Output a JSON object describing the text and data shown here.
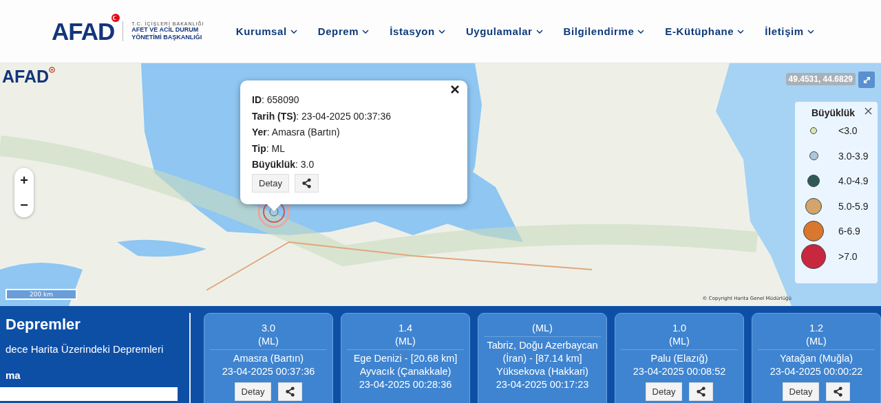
{
  "header": {
    "logo": "AFAD",
    "ministry": "T.C. İÇİŞLERİ BAKANLIĞI",
    "agency_lines": [
      "AFET VE ACİL DURUM",
      "YÖNETİMİ BAŞKANLIĞI"
    ],
    "nav": [
      "Kurumsal",
      "Deprem",
      "İstasyon",
      "Uygulamalar",
      "Bilgilendirme",
      "E-Kütüphane",
      "İletişim"
    ]
  },
  "map": {
    "logo": "AFAD",
    "coordinates": "49.4531, 44.6829",
    "scale": "200 km",
    "copyright": "© Copyright Harita Genel Müdürlüğü",
    "zoom": [
      "+",
      "−"
    ],
    "popup": {
      "lines": [
        "**ID**: 658090",
        "**Tarih (TS)**: 23-04-2025 00:37:36",
        "**Yer**: Amasra (Bartın)",
        "**Tip**: ML",
        "**Büyüklük**: 3.0"
      ],
      "detail_button": "Detay"
    },
    "legend": {
      "title": "Büyüklük",
      "items": [
        {
          "label": "<3.0",
          "color": "#d8e6b0"
        },
        {
          "label": "3.0-3.9",
          "color": "#a9c7df"
        },
        {
          "label": "4.0-4.9",
          "color": "#2e5a55"
        },
        {
          "label": "5.0-5.9",
          "color": "#d1a56c"
        },
        {
          "label": "6-6.9",
          "color": "#d9772f"
        },
        {
          "label": ">7.0",
          "color": "#c7283f"
        }
      ]
    }
  },
  "panel": {
    "title": "Depremler",
    "filter_text": "dece Harita Üzerindeki Depremleri",
    "section_label": "ma"
  },
  "cards": [
    {
      "magnitude": "3.0",
      "type": "(ML)",
      "place": "Amasra (Bartın)",
      "time": "23-04-2025 00:37:36",
      "detail_button": "Detay"
    },
    {
      "magnitude": "1.4",
      "type": "(ML)",
      "place": "Ege Denizi - [20.68 km] Ayvacık (Çanakkale)",
      "time": "23-04-2025 00:28:36"
    },
    {
      "type": "(ML)",
      "place": "Tabriz, Doğu Azerbaycan (İran) - [87.14 km] Yüksekova (Hakkari)",
      "time": "23-04-2025 00:17:23"
    },
    {
      "magnitude": "1.0",
      "type": "(ML)",
      "place": "Palu (Elazığ)",
      "time": "23-04-2025 00:08:52",
      "detail_button": "Detay"
    },
    {
      "magnitude": "1.2",
      "type": "(ML)",
      "place": "Yatağan (Muğla)",
      "time": "23-04-2025 00:00:22",
      "detail_button": "Detay"
    }
  ]
}
